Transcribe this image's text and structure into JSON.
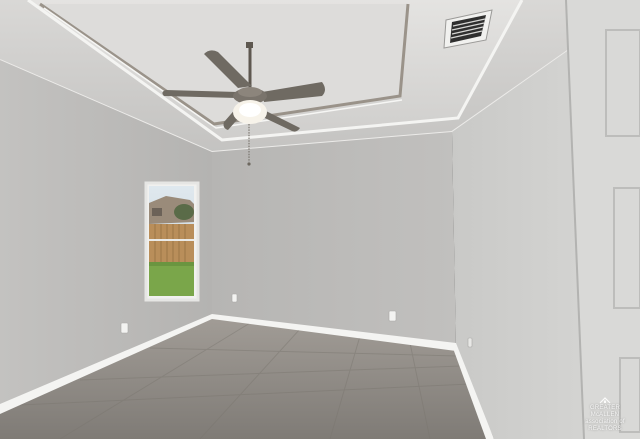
{
  "scene": {
    "subject": "empty-room-interior",
    "colors": {
      "ceiling": "#c9c8c6",
      "left_wall": "#bdbcbb",
      "back_wall": "#b9b8b6",
      "right_wall": "#cfcfcd",
      "floor": "#8f8b86",
      "baseboard": "#f2f2f0",
      "fan_blade": "#6f6a62",
      "grass": "#7aa64a",
      "fence": "#b98e5a"
    }
  },
  "watermark": {
    "line1": "GREATER McALLEN",
    "line2": "association of REALTORS",
    "icon": "house-roof-icon"
  }
}
